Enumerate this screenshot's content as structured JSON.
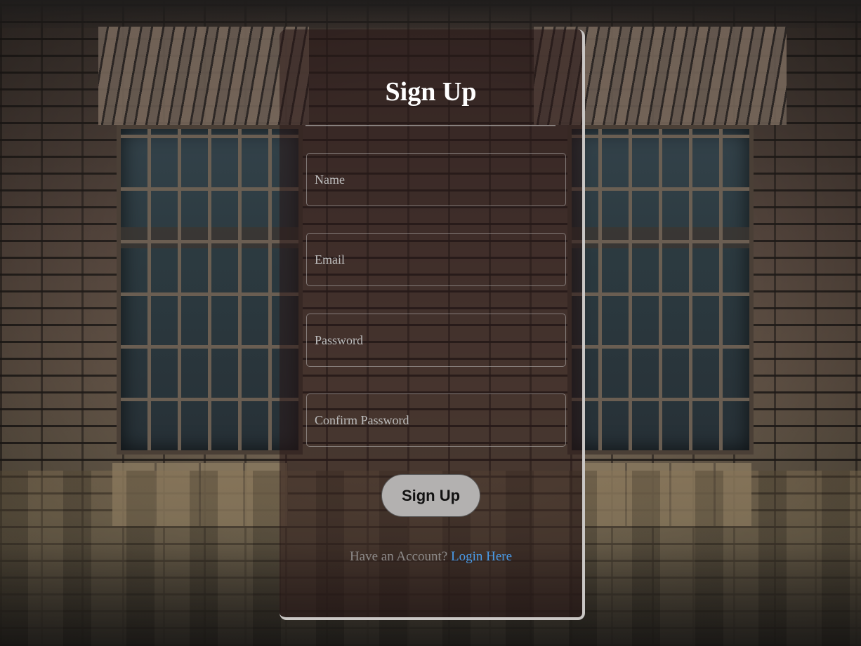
{
  "form": {
    "title": "Sign Up",
    "fields": [
      {
        "name": "name",
        "placeholder": "Name",
        "value": ""
      },
      {
        "name": "email",
        "placeholder": "Email",
        "value": ""
      },
      {
        "name": "password",
        "placeholder": "Password",
        "value": ""
      },
      {
        "name": "confirm_password",
        "placeholder": "Confirm Password",
        "value": ""
      }
    ],
    "submit_label": "Sign Up",
    "footer_text": "Have an Account?",
    "login_link_label": "Login Here"
  },
  "colors": {
    "link": "#4a9be8",
    "button_bg": "#b3b1b0",
    "title": "#ffffff"
  }
}
